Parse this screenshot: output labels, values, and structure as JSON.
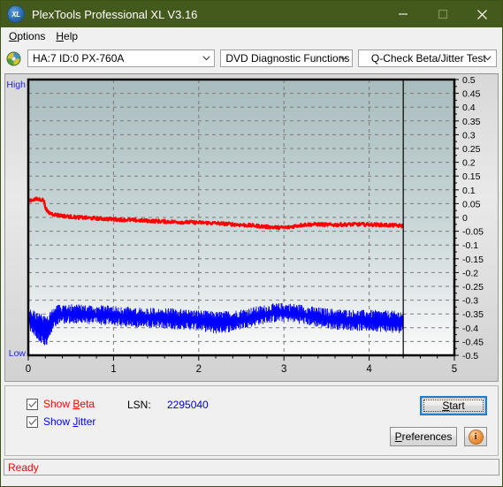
{
  "window": {
    "title": "PlexTools Professional XL V3.16",
    "app_icon": "xl-logo-icon",
    "minimize": "minimize-icon",
    "maximize": "maximize-icon",
    "close": "close-icon"
  },
  "menu": {
    "items": [
      {
        "label": "Options",
        "accel": "O"
      },
      {
        "label": "Help",
        "accel": "H"
      }
    ]
  },
  "toolbar": {
    "drive_icon": "optical-disc-icon",
    "drive": "HA:7 ID:0  PX-760A",
    "function": "DVD Diagnostic Functions",
    "test": "Q-Check Beta/Jitter Test"
  },
  "chart_data": {
    "type": "line",
    "title": "",
    "xlabel": "",
    "ylabel": "",
    "axis_left_top_label": "High",
    "axis_left_bottom_label": "Low",
    "xlim": [
      0,
      5
    ],
    "ylim": [
      -0.5,
      0.5
    ],
    "xticks": [
      0,
      1,
      2,
      3,
      4,
      5
    ],
    "xtick_labels": [
      "0",
      "1",
      "2",
      "3",
      "4",
      "5"
    ],
    "yticks": [
      0.5,
      0.45,
      0.4,
      0.35,
      0.3,
      0.25,
      0.2,
      0.15,
      0.1,
      0.05,
      0,
      -0.05,
      -0.1,
      -0.15,
      -0.2,
      -0.25,
      -0.3,
      -0.35,
      -0.4,
      -0.45,
      -0.5
    ],
    "ytick_labels": [
      "0.5",
      "0.45",
      "0.4",
      "0.35",
      "0.3",
      "0.25",
      "0.2",
      "0.15",
      "0.1",
      "0.05",
      "0",
      "-0.05",
      "-0.1",
      "-0.15",
      "-0.2",
      "-0.25",
      "-0.3",
      "-0.35",
      "-0.4",
      "-0.45",
      "-0.5"
    ],
    "grid": true,
    "grid_style": "dashed",
    "data_end_marker_x": 4.4,
    "legend_position": "below-plot",
    "series": [
      {
        "name": "Beta",
        "color": "#ff0000",
        "visible": true,
        "noise": 0.006,
        "x": [
          0.0,
          0.05,
          0.1,
          0.14,
          0.18,
          0.2,
          0.22,
          0.25,
          0.28,
          0.32,
          0.38,
          0.45,
          0.55,
          0.7,
          0.9,
          1.1,
          1.3,
          1.55,
          1.8,
          2.05,
          2.2,
          2.35,
          2.5,
          2.65,
          2.8,
          2.95,
          3.05,
          3.15,
          3.25,
          3.4,
          3.55,
          3.7,
          3.85,
          4.0,
          4.15,
          4.3,
          4.4
        ],
        "y": [
          0.062,
          0.064,
          0.066,
          0.065,
          0.063,
          0.04,
          0.022,
          0.016,
          0.013,
          0.01,
          0.007,
          0.004,
          0.001,
          -0.002,
          -0.005,
          -0.008,
          -0.011,
          -0.014,
          -0.017,
          -0.019,
          -0.021,
          -0.024,
          -0.027,
          -0.03,
          -0.034,
          -0.037,
          -0.036,
          -0.03,
          -0.026,
          -0.025,
          -0.027,
          -0.026,
          -0.025,
          -0.026,
          -0.027,
          -0.029,
          -0.031
        ]
      },
      {
        "name": "Jitter",
        "color": "#0000ff",
        "visible": true,
        "band": true,
        "x": [
          0.0,
          0.05,
          0.1,
          0.14,
          0.18,
          0.22,
          0.26,
          0.3,
          0.36,
          0.45,
          0.6,
          0.75,
          0.9,
          1.05,
          1.2,
          1.4,
          1.6,
          1.8,
          2.0,
          2.2,
          2.4,
          2.55,
          2.7,
          2.8,
          2.9,
          3.0,
          3.1,
          3.2,
          3.3,
          3.45,
          3.6,
          3.75,
          3.9,
          4.05,
          4.2,
          4.32,
          4.4
        ],
        "y_top": [
          -0.345,
          -0.35,
          -0.358,
          -0.362,
          -0.37,
          -0.372,
          -0.35,
          -0.338,
          -0.33,
          -0.328,
          -0.33,
          -0.332,
          -0.334,
          -0.336,
          -0.34,
          -0.342,
          -0.344,
          -0.346,
          -0.35,
          -0.356,
          -0.352,
          -0.344,
          -0.336,
          -0.33,
          -0.326,
          -0.324,
          -0.326,
          -0.33,
          -0.336,
          -0.342,
          -0.346,
          -0.348,
          -0.35,
          -0.35,
          -0.352,
          -0.354,
          -0.352
        ],
        "y_bot": [
          -0.392,
          -0.404,
          -0.424,
          -0.438,
          -0.448,
          -0.45,
          -0.412,
          -0.386,
          -0.374,
          -0.37,
          -0.372,
          -0.374,
          -0.378,
          -0.38,
          -0.384,
          -0.386,
          -0.39,
          -0.392,
          -0.396,
          -0.408,
          -0.4,
          -0.386,
          -0.376,
          -0.37,
          -0.366,
          -0.364,
          -0.366,
          -0.372,
          -0.378,
          -0.386,
          -0.392,
          -0.394,
          -0.398,
          -0.398,
          -0.402,
          -0.408,
          -0.4
        ]
      }
    ]
  },
  "controls": {
    "show_beta": {
      "label_pre": "Show ",
      "label_accel": "B",
      "label_post": "eta",
      "checked": true,
      "check_icon": "checkmark-icon"
    },
    "show_jitter": {
      "label_pre": "Show ",
      "label_accel": "J",
      "label_post": "itter",
      "checked": true,
      "check_icon": "checkmark-icon"
    },
    "lsn_label": "LSN:",
    "lsn_value": "2295040",
    "start": {
      "label_pre": "",
      "label_accel": "S",
      "label_post": "tart"
    },
    "preferences": {
      "label_pre": "",
      "label_accel": "P",
      "label_post": "references"
    },
    "info": {
      "icon": "info-icon",
      "glyph": "i"
    }
  },
  "status": {
    "text": "Ready"
  },
  "colors": {
    "titlebar": "#44591c",
    "beta": "#ff0000",
    "jitter": "#0000ff",
    "accent_focus": "#1b7fd6",
    "status": "#ff0000",
    "lsn": "#0000cd"
  }
}
